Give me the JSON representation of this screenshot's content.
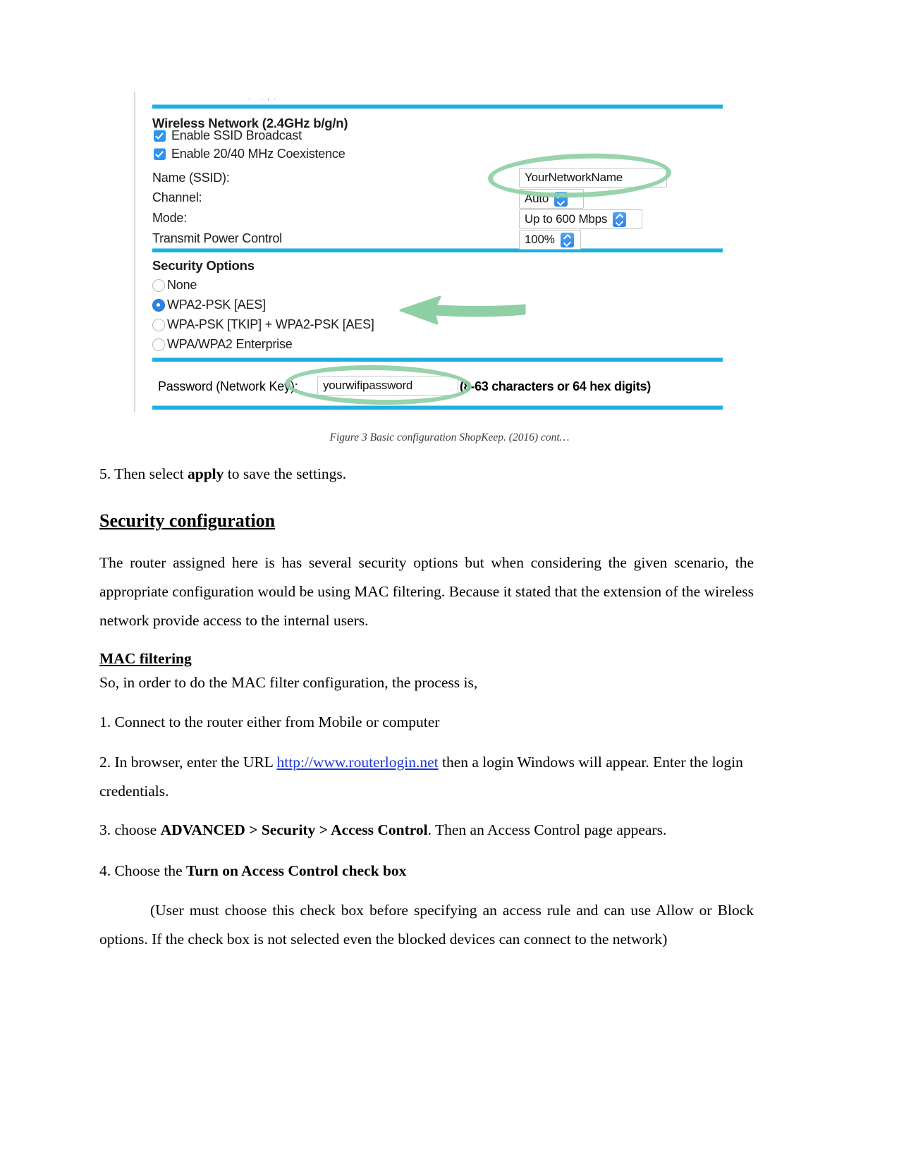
{
  "figure": {
    "artifact_text": ". .,.",
    "wireless_section_title": "Wireless Network (2.4GHz b/g/n)",
    "checkboxes": [
      {
        "label": "Enable SSID Broadcast",
        "checked": true
      },
      {
        "label": "Enable 20/40 MHz Coexistence",
        "checked": true
      }
    ],
    "fields": [
      {
        "label": "Name (SSID):",
        "value": "YourNetworkName",
        "control": "text-input"
      },
      {
        "label": "Channel:",
        "value": "Auto",
        "control": "dropdown"
      },
      {
        "label": "Mode:",
        "value": "Up to 600 Mbps",
        "control": "dropdown"
      },
      {
        "label": "Transmit Power Control",
        "value": "100%",
        "control": "dropdown"
      }
    ],
    "security_section_title": "Security Options",
    "security_options": [
      {
        "label": "None",
        "selected": false
      },
      {
        "label": "WPA2-PSK [AES]",
        "selected": true
      },
      {
        "label": "WPA-PSK [TKIP] + WPA2-PSK [AES]",
        "selected": false
      },
      {
        "label": "WPA/WPA2 Enterprise",
        "selected": false
      }
    ],
    "password_label": "Password (Network Key):",
    "password_value": "yourwifipassword",
    "password_hint": "(8-63 characters or 64 hex digits)",
    "annotations": {
      "oval_ssid": "green-oval-around-ssid-field",
      "oval_password": "green-oval-around-password-field",
      "arrow": "green-arrow-pointing-to-wpa2-psk-aes"
    },
    "colors": {
      "divider": "#1eaee0",
      "checkbox": "#2b95f0",
      "radio_selected": "#2b84e8",
      "stepper": "#2b84e8",
      "annotation_green": "#8fcfa4"
    }
  },
  "caption": "Figure 3 Basic configuration ShopKeep. (2016) cont…",
  "body": {
    "step5": {
      "prefix": "5. Then select ",
      "bold": "apply",
      "suffix": " to save the settings."
    },
    "security_heading": "Security configuration",
    "intro_paragraph": "The router assigned here is has several security options but when considering the given scenario, the appropriate configuration would be using MAC filtering. Because it stated that the extension of the wireless network provide access to the internal users.",
    "mac_heading": "MAC filtering ",
    "mac_line": "So, in order to do the MAC filter configuration, the process is,",
    "step1": "1. Connect to the router either from Mobile or computer",
    "step2": {
      "prefix": "2. In browser, enter the URL ",
      "link": "http://www.routerlogin.net",
      "suffix": " then a login Windows will appear. Enter the login credentials."
    },
    "step3": {
      "prefix": "3. choose ",
      "bold": "ADVANCED > Security > Access Control",
      "suffix": ". Then an Access Control page appears."
    },
    "step4": {
      "prefix": "4. Choose the ",
      "bold": "Turn on Access Control check box"
    },
    "note": "(User must choose this check box before specifying an access rule and can use Allow or Block options. If the check box is not selected even the blocked devices can connect to the network)"
  }
}
